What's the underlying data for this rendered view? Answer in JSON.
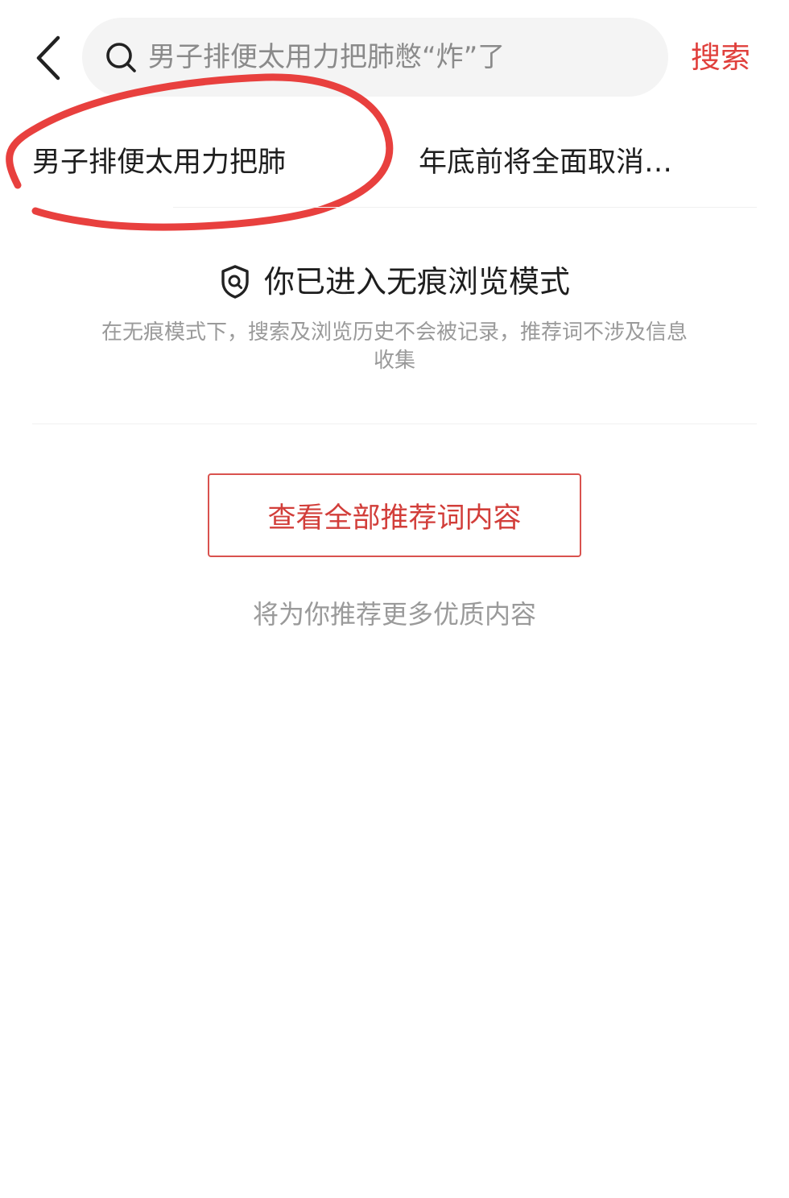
{
  "header": {
    "search_placeholder": "男子排便太用力把肺憋“炸”了",
    "search_button_label": "搜索"
  },
  "suggestions": [
    {
      "label": "男子排便太用力把肺"
    },
    {
      "label": "年底前将全面取消…"
    }
  ],
  "incognito": {
    "title": "你已进入无痕浏览模式",
    "description": "在无痕模式下，搜索及浏览历史不会被记录，推荐词不涉及信息收集"
  },
  "recommend": {
    "button_label": "查看全部推荐词内容",
    "note": "将为你推荐更多优质内容"
  },
  "colors": {
    "accent": "#e0403c",
    "annotation": "#e8403e",
    "muted_text": "#9a9a9a",
    "search_bg": "#f4f4f4"
  },
  "icons": {
    "back": "chevron-left-icon",
    "search": "search-icon",
    "incognito": "shield-search-icon"
  }
}
